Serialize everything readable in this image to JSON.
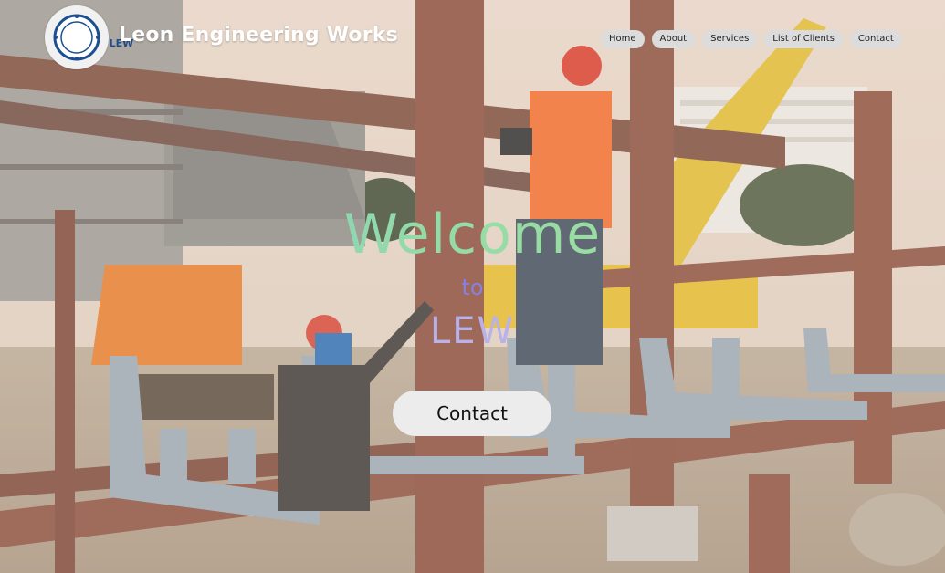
{
  "header": {
    "logo_text": "LEW",
    "brand_name": "Leon Engineering Works"
  },
  "nav": {
    "items": [
      {
        "label": "Home"
      },
      {
        "label": "About"
      },
      {
        "label": "Services"
      },
      {
        "label": "List of Clients"
      },
      {
        "label": "Contact"
      }
    ]
  },
  "hero": {
    "welcome": "Welcome",
    "to": "to",
    "abbreviation": "LEW",
    "cta_label": "Contact"
  },
  "colors": {
    "nav_pill": "#dcdcdc",
    "welcome_gradient_start": "#7fc6d8",
    "welcome_gradient_end": "#a5e09a",
    "to_text": "#8a7ee0",
    "lew_text": "#b9b2ea",
    "logo_blue": "#1b4f8f",
    "cta_background": "#ececec"
  },
  "icons": {
    "logo": "company-logo-icon"
  }
}
